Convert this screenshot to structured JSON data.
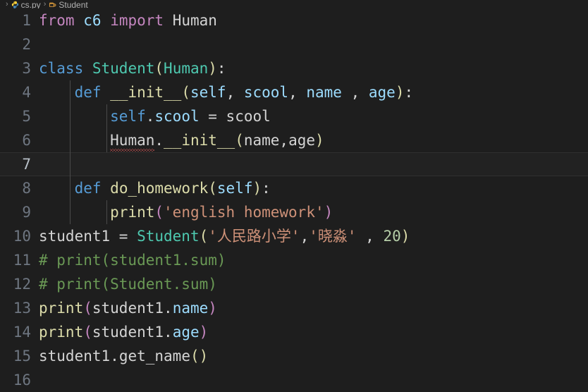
{
  "breadcrumb": {
    "separator": "›",
    "items": [
      {
        "label": "cs.py",
        "icon": "python-file-icon"
      },
      {
        "label": "Student",
        "icon": "class-symbol-icon"
      }
    ]
  },
  "editor": {
    "language": "python",
    "active_line": 7,
    "colors": {
      "background": "#1e1e1e",
      "active_line_background": "#222222",
      "line_number": "#6e7681",
      "active_line_number": "#b8c0c8",
      "keyword": "#C586C0",
      "control": "#569CD6",
      "class_name": "#4EC9B0",
      "variable": "#9CDCFE",
      "function": "#DCDCAA",
      "string": "#CE9178",
      "number": "#B5CEA8",
      "comment": "#6A9955",
      "plain_text": "#d4d4d4",
      "error_squiggle": "#e05c5c",
      "indent_guide": "#4a4a4a"
    },
    "lines": [
      {
        "n": "1",
        "text": "from c6 import Human"
      },
      {
        "n": "2",
        "text": ""
      },
      {
        "n": "3",
        "text": "class Student(Human):"
      },
      {
        "n": "4",
        "text": "    def __init__(self, scool, name , age):"
      },
      {
        "n": "5",
        "text": "        self.scool = scool"
      },
      {
        "n": "6",
        "text": "        Human.__init__(name,age)"
      },
      {
        "n": "7",
        "text": ""
      },
      {
        "n": "8",
        "text": "    def do_homework(self):"
      },
      {
        "n": "9",
        "text": "        print('english homework')"
      },
      {
        "n": "10",
        "text": "student1 = Student('人民路小学','晓淼' , 20)"
      },
      {
        "n": "11",
        "text": "# print(student1.sum)"
      },
      {
        "n": "12",
        "text": "# print(Student.sum)"
      },
      {
        "n": "13",
        "text": "print(student1.name)"
      },
      {
        "n": "14",
        "text": "print(student1.age)"
      },
      {
        "n": "15",
        "text": "student1.get_name()"
      },
      {
        "n": "16",
        "text": ""
      }
    ],
    "tokens": {
      "l1": {
        "from": "from",
        "module": "c6",
        "import": "import",
        "name": "Human"
      },
      "l3": {
        "class": "class",
        "name": "Student",
        "open": "(",
        "base": "Human",
        "close": ")",
        "colon": ":"
      },
      "l4": {
        "def": "def",
        "name": "__init__",
        "open": "(",
        "p1": "self",
        "c1": ", ",
        "p2": "scool",
        "c2": ", ",
        "p3": "name",
        "c3": " , ",
        "p4": "age",
        "close": ")",
        "colon": ":"
      },
      "l5": {
        "self": "self",
        "dot": ".",
        "attr": "scool",
        "eq": " = ",
        "val": "scool"
      },
      "l6": {
        "obj": "Human",
        "dot": ".",
        "method": "__init__",
        "open": "(",
        "a1": "name",
        "comma": ",",
        "a2": "age",
        "close": ")"
      },
      "l8": {
        "def": "def",
        "name": "do_homework",
        "open": "(",
        "p1": "self",
        "close": ")",
        "colon": ":"
      },
      "l9": {
        "fn": "print",
        "open": "(",
        "str": "'english homework'",
        "close": ")"
      },
      "l10": {
        "var": "student1",
        "eq": " = ",
        "cls": "Student",
        "open": "(",
        "s1": "'人民路小学'",
        "c1": ",",
        "s2": "'晓淼'",
        "c2": " , ",
        "num": "20",
        "close": ")"
      },
      "l11": {
        "comment": "# print(student1.sum)"
      },
      "l12": {
        "comment": "# print(Student.sum)"
      },
      "l13": {
        "fn": "print",
        "open": "(",
        "obj": "student1",
        "dot": ".",
        "prop": "name",
        "close": ")"
      },
      "l14": {
        "fn": "print",
        "open": "(",
        "obj": "student1",
        "dot": ".",
        "prop": "age",
        "close": ")"
      },
      "l15": {
        "obj": "student1",
        "dot": ".",
        "method": "get_name",
        "open": "(",
        "close": ")"
      }
    }
  }
}
